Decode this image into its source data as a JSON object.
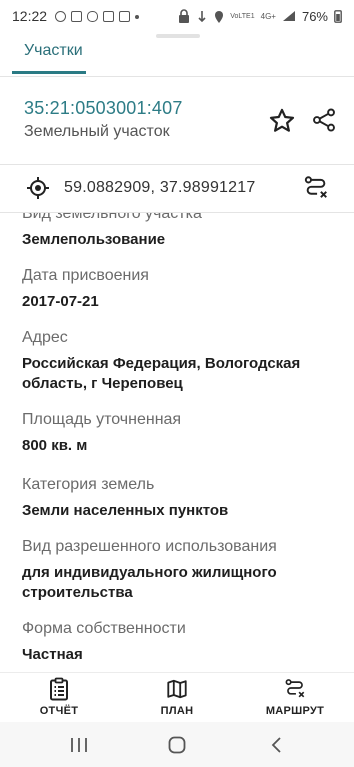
{
  "status_bar": {
    "time": "12:22",
    "network": "4G+",
    "carrier_tag": "VoLTE1",
    "battery": "76%"
  },
  "header": {
    "tab_label": "Участки"
  },
  "parcel": {
    "cadastral_number": "35:21:0503001:407",
    "type": "Земельный участок"
  },
  "coordinates": {
    "text": "59.0882909, 37.98991217"
  },
  "fields": [
    {
      "label": "Вид земельного участка",
      "value": "Землепользование"
    },
    {
      "label": "Дата присвоения",
      "value": "2017-07-21"
    },
    {
      "label": "Адрес",
      "value_line1": "Российская Федерация, Вологодская",
      "value_line2": "область, г Череповец"
    },
    {
      "label": "Площадь уточненная",
      "value": "800 кв. м"
    },
    {
      "label": "Категория земель",
      "value": "Земли населенных пунктов"
    },
    {
      "label": "Вид разрешенного использования",
      "value_line1": "для индивидуального жилищного",
      "value_line2": "строительства"
    },
    {
      "label": "Форма собственности",
      "value": "Частная"
    }
  ],
  "bottom_nav": {
    "report_label": "ОТЧЁТ",
    "plan_label": "ПЛАН",
    "route_label": "МАРШРУТ"
  },
  "icons": {
    "status_left": [
      "whatsapp-icon",
      "messages-icon",
      "gamepad-icon",
      "notification-icon",
      "youtube-icon",
      "dot-icon"
    ],
    "status_right": [
      "lock-icon",
      "data-icon",
      "location-icon",
      "wifi-icon",
      "signal-icon",
      "battery-icon"
    ],
    "actions": [
      "star-icon",
      "share-icon",
      "target-icon",
      "route-icon",
      "report-icon",
      "map-icon",
      "route-icon"
    ]
  },
  "colors": {
    "accent": "#2a7a84",
    "link_text": "#2d7c86"
  }
}
